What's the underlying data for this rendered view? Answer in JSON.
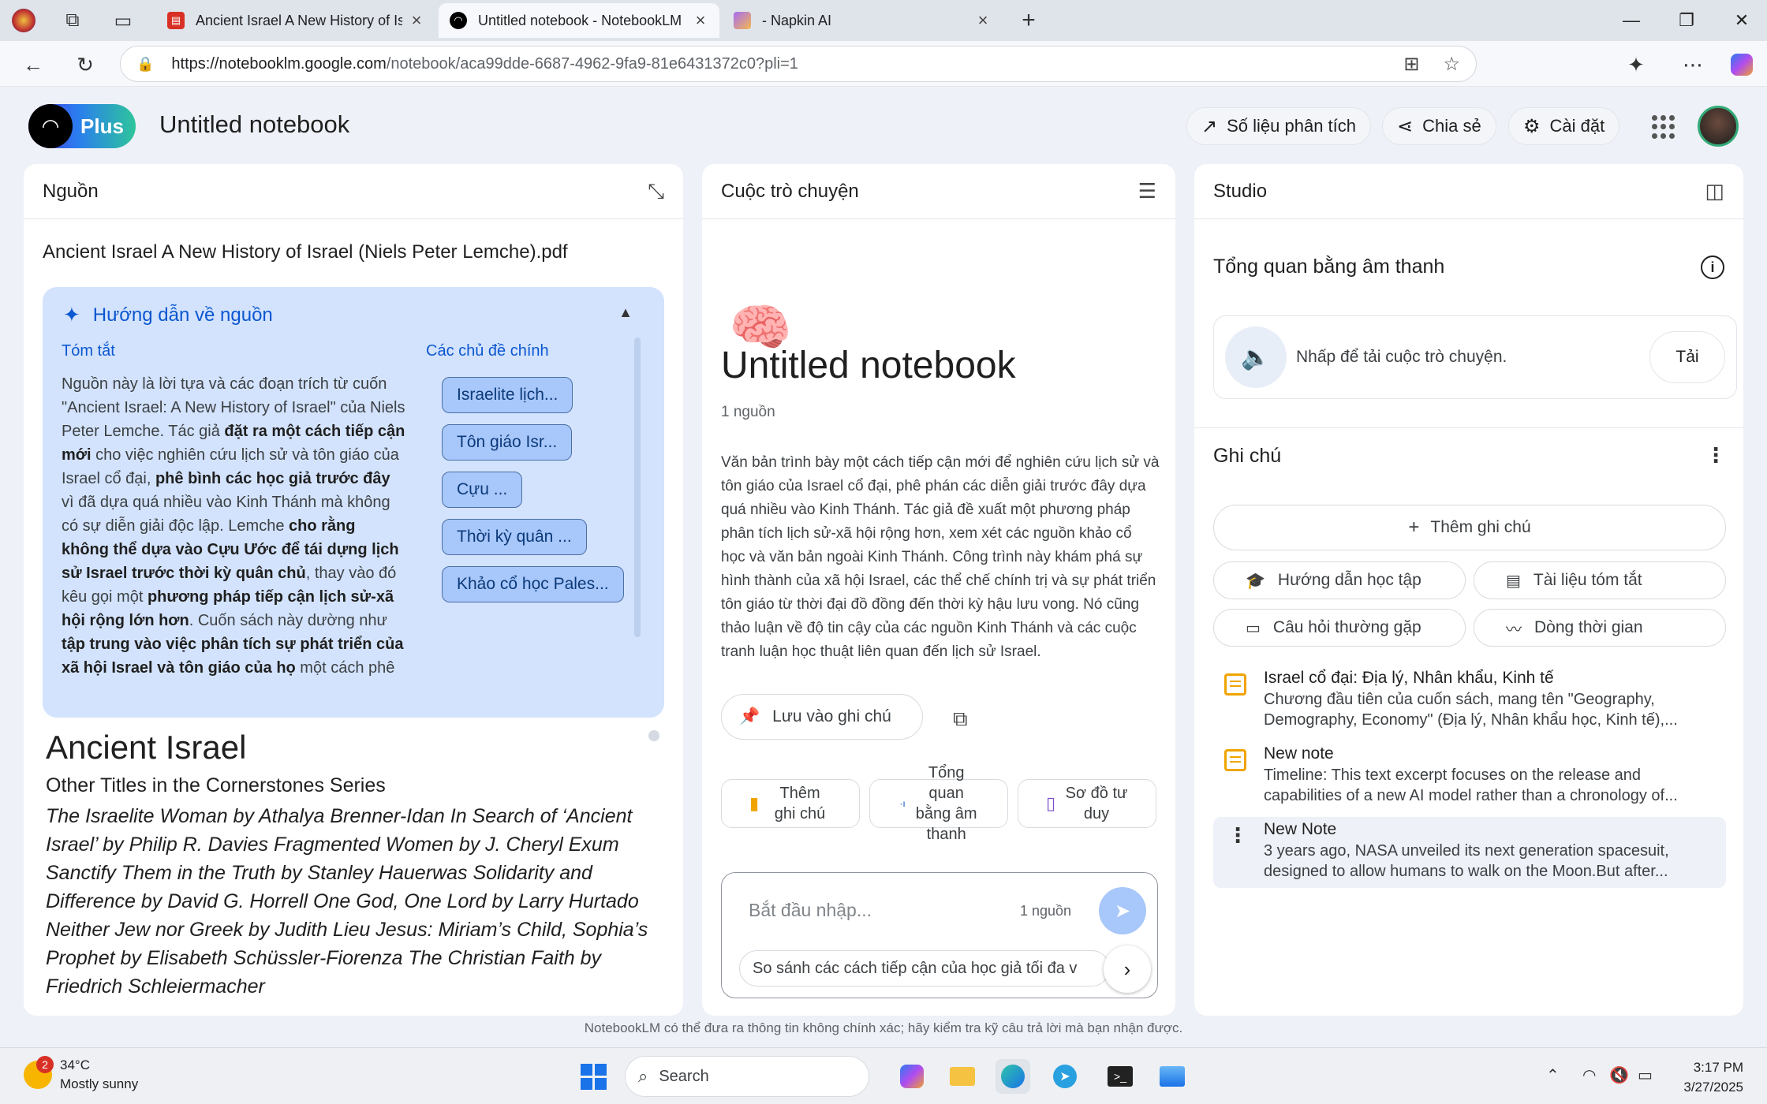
{
  "browser": {
    "tabs": [
      {
        "title": "Ancient Israel A New History of Is",
        "active": false
      },
      {
        "title": "Untitled notebook - NotebookLM",
        "active": true
      },
      {
        "title": "- Napkin AI",
        "active": false
      }
    ],
    "new_tab": "+",
    "url_host": "https://notebooklm.google.com",
    "url_path": "/notebook/aca99dde-6687-4962-9fa9-81e6431372c0?pli=1"
  },
  "header": {
    "plus_label": "Plus",
    "notebook_title": "Untitled notebook",
    "analytics": "Số liệu phân tích",
    "share": "Chia sẻ",
    "settings": "Cài đặt"
  },
  "sources": {
    "title": "Nguồn",
    "file_name": "Ancient Israel A New History of Israel (Niels Peter Lemche).pdf",
    "guide": {
      "title": "Hướng dẫn về nguồn",
      "summary_label": "Tóm tắt",
      "topics_label": "Các chủ đề chính",
      "summary_parts": [
        {
          "t": "Nguồn này là lời tựa và các đoạn trích từ cuốn \"Ancient Israel: A New History of Israel\" của Niels Peter Lemche. Tác giả ",
          "b": false
        },
        {
          "t": "đặt ra một cách tiếp cận mới",
          "b": true
        },
        {
          "t": " cho việc nghiên cứu lịch sử và tôn giáo của Israel cổ đại, ",
          "b": false
        },
        {
          "t": "phê bình các học giả trước đây",
          "b": true
        },
        {
          "t": " vì đã dựa quá nhiều vào Kinh Thánh mà không có sự diễn giải độc lập. Lemche ",
          "b": false
        },
        {
          "t": "cho rằng không thể dựa vào Cựu Ước để tái dựng lịch sử Israel trước thời kỳ quân chủ",
          "b": true
        },
        {
          "t": ", thay vào đó kêu gọi một ",
          "b": false
        },
        {
          "t": "phương pháp tiếp cận lịch sử-xã hội rộng lớn hơn",
          "b": true
        },
        {
          "t": ". Cuốn sách này dường như ",
          "b": false
        },
        {
          "t": "tập trung vào việc phân tích sự phát triển của xã hội Israel và tôn giáo của họ",
          "b": true
        },
        {
          "t": " một cách phê",
          "b": false
        }
      ],
      "topics": [
        "Israelite lịch...",
        "Tôn giáo Isr...",
        "Cựu ...",
        "Thời kỳ quân ...",
        "Khảo cổ học Pales..."
      ]
    },
    "doc_heading": "Ancient Israel",
    "doc_subheading": "Other Titles in the Cornerstones Series",
    "doc_body": "The Israelite Woman by Athalya Brenner-Idan In Search of ‘Ancient Israel’ by Philip R. Davies Fragmented Women by J. Cheryl Exum Sanctify Them in the Truth by Stanley Hauerwas Solidarity and Difference by David G. Horrell One God, One Lord by Larry Hurtado Neither Jew nor Greek by Judith Lieu Jesus: Miriam’s Child, Sophia’s Prophet by Elisabeth Schüssler-Fiorenza The Christian Faith by Friedrich Schleiermacher"
  },
  "chat": {
    "title": "Cuộc trò chuyện",
    "notebook_title": "Untitled notebook",
    "source_count": "1 nguồn",
    "summary": "Văn bản trình bày một cách tiếp cận mới để nghiên cứu lịch sử và tôn giáo của Israel cổ đại, phê phán các diễn giải trước đây dựa quá nhiều vào Kinh Thánh. Tác giả đề xuất một phương pháp phân tích lịch sử-xã hội rộng hơn, xem xét các nguồn khảo cổ học và văn bản ngoài Kinh Thánh. Công trình này khám phá sự hình thành của xã hội Israel, các thể chế chính trị và sự phát triển tôn giáo từ thời đại đồ đồng đến thời kỳ hậu lưu vong. Nó cũng thảo luận về độ tin cậy của các nguồn Kinh Thánh và các cuộc tranh luận học thuật liên quan đến lịch sử Israel.",
    "save_to_note": "Lưu vào ghi chú",
    "suggestions": [
      "Thêm ghi chú",
      "Tổng quan bằng âm thanh",
      "Sơ đồ tư duy"
    ],
    "input_placeholder": "Bắt đầu nhập...",
    "input_source_count": "1 nguồn",
    "suggested_question": "So sánh các cách tiếp cận của học giả tối đa v"
  },
  "studio": {
    "title": "Studio",
    "audio_heading": "Tổng quan bằng âm thanh",
    "audio_text": "Nhấp để tải cuộc trò chuyện.",
    "audio_load": "Tải",
    "notes_heading": "Ghi chú",
    "add_note": "Thêm ghi chú",
    "chips": [
      "Hướng dẫn học tập",
      "Tài liệu tóm tắt",
      "Câu hỏi thường gặp",
      "Dòng thời gian"
    ],
    "notes": [
      {
        "title": "Israel cổ đại: Địa lý, Nhân khẩu, Kinh tế",
        "body": "Chương đầu tiên của cuốn sách, mang tên \"Geography, Demography, Economy\" (Địa lý, Nhân khẩu học, Kinh tế),..."
      },
      {
        "title": "New note",
        "body": "Timeline: This text excerpt focuses on the release and capabilities of a new AI model rather than a chronology of..."
      },
      {
        "title": "New Note",
        "body": "3 years ago, NASA unveiled its next generation spacesuit, designed to allow humans to walk on the Moon.But after..."
      }
    ]
  },
  "disclaimer": "NotebookLM có thể đưa ra thông tin không chính xác; hãy kiểm tra kỹ câu trả lời mà bạn nhận được.",
  "taskbar": {
    "weather_badge": "2",
    "temperature": "34°C",
    "condition": "Mostly sunny",
    "search_label": "Search",
    "time": "3:17 PM",
    "date": "3/27/2025"
  },
  "colors": {
    "accent": "#0b57d0",
    "guide_bg": "#d3e3fd",
    "chip_bg": "#a8c7fa",
    "note_icon": "#f0a400"
  }
}
